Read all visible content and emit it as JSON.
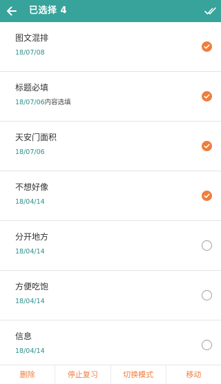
{
  "header": {
    "title": "已选择 4"
  },
  "items": [
    {
      "title": "图文混排",
      "date": "18/07/08",
      "extra": "",
      "checked": true
    },
    {
      "title": "标题必填",
      "date": "18/07/06",
      "extra": "内容选填",
      "checked": true
    },
    {
      "title": "天安门面积",
      "date": "18/07/06",
      "extra": "",
      "checked": true
    },
    {
      "title": "不想好像",
      "date": "18/04/14",
      "extra": "",
      "checked": true
    },
    {
      "title": "分开地方",
      "date": "18/04/14",
      "extra": "",
      "checked": false
    },
    {
      "title": "方便吃饱",
      "date": "18/04/14",
      "extra": "",
      "checked": false
    },
    {
      "title": "信息",
      "date": "18/04/14",
      "extra": "",
      "checked": false
    }
  ],
  "bottom_bar": {
    "delete": "删除",
    "stop_review": "停止复习",
    "switch_mode": "切换模式",
    "move": "移动"
  },
  "colors": {
    "header_bg": "#38a39b",
    "accent": "#ef7d3c",
    "date_text": "#2a8f8a"
  },
  "icons": {
    "back": "arrow-left-icon",
    "select_all": "double-check-icon",
    "checked": "check-circle-icon",
    "unchecked": "empty-circle-icon"
  }
}
